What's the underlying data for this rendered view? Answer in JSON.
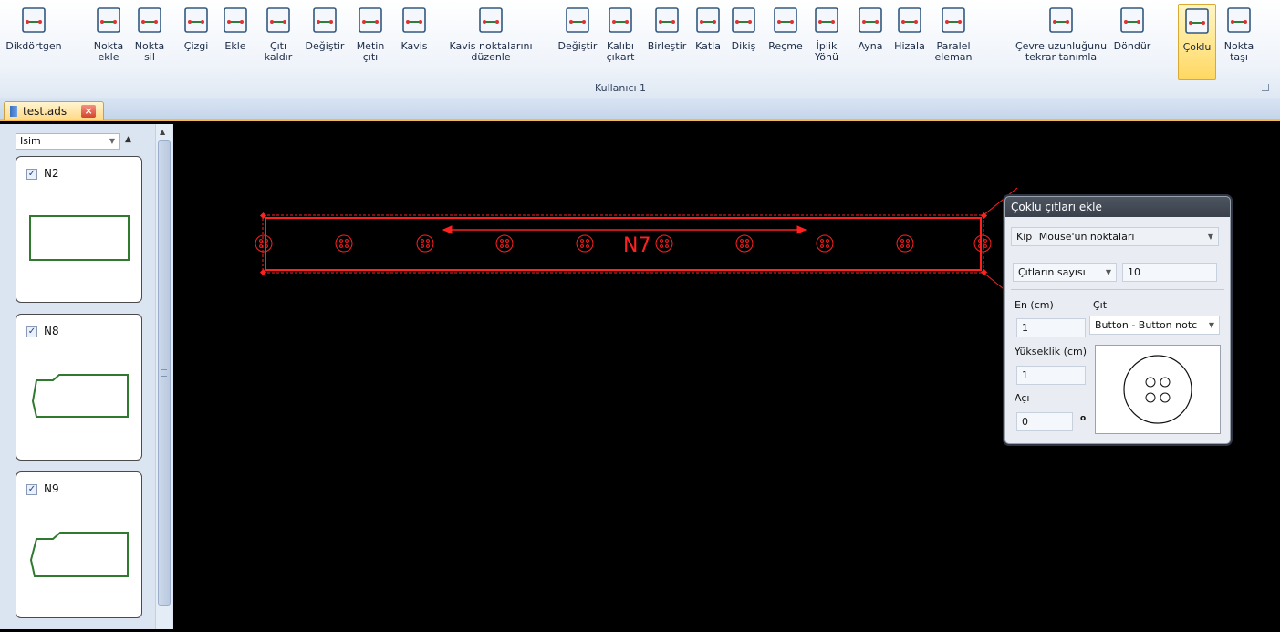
{
  "ribbon": {
    "group_label": "Kullanıcı 1",
    "tools": [
      {
        "label": "Dikdörtgen",
        "icon": "rectangle-icon"
      },
      {
        "label": "Nokta\nekle",
        "icon": "add-point-icon"
      },
      {
        "label": "Nokta\nsil",
        "icon": "delete-point-icon"
      },
      {
        "label": "Çizgi",
        "icon": "line-icon"
      },
      {
        "label": "Ekle",
        "icon": "insert-icon"
      },
      {
        "label": "Çıtı\nkaldır",
        "icon": "remove-notch-icon"
      },
      {
        "label": "Değiştir",
        "icon": "change-notch-icon"
      },
      {
        "label": "Metin\nçıtı",
        "icon": "text-notch-icon"
      },
      {
        "label": "Kavis",
        "icon": "curve-icon"
      },
      {
        "label": "Kavis noktalarını\ndüzenle",
        "icon": "edit-curve-points-icon"
      },
      {
        "label": "Değiştir",
        "icon": "modify-icon"
      },
      {
        "label": "Kalıbı\nçıkart",
        "icon": "extract-pattern-icon"
      },
      {
        "label": "Birleştir",
        "icon": "merge-icon"
      },
      {
        "label": "Katla",
        "icon": "fold-icon"
      },
      {
        "label": "Dikiş",
        "icon": "seam-icon"
      },
      {
        "label": "Reçme",
        "icon": "pleat-icon"
      },
      {
        "label": "İplik\nYönü",
        "icon": "grain-line-icon"
      },
      {
        "label": "Ayna",
        "icon": "mirror-icon"
      },
      {
        "label": "Hizala",
        "icon": "align-icon"
      },
      {
        "label": "Paralel\neleman",
        "icon": "parallel-icon"
      },
      {
        "label": "Çevre uzunluğunu\ntekrar tanımla",
        "icon": "perimeter-icon"
      },
      {
        "label": "Döndür",
        "icon": "rotate-icon"
      },
      {
        "label": "Çoklu",
        "icon": "multiple-notches-icon",
        "active": true
      },
      {
        "label": "Nokta\ntaşı",
        "icon": "move-point-icon"
      }
    ]
  },
  "tabs": {
    "doc_name": "test.ads",
    "close": "×"
  },
  "sidebar": {
    "sort_field": "Isim",
    "pieces": [
      {
        "name": "N2",
        "checked": "✓"
      },
      {
        "name": "N8",
        "checked": "✓"
      },
      {
        "name": "N9",
        "checked": "✓"
      }
    ]
  },
  "canvas": {
    "piece_label": "N7",
    "color": "#ff2020"
  },
  "dialog": {
    "title": "Çoklu çıtları ekle",
    "kip_label": "Kip",
    "kip_value": "Mouse'un noktaları",
    "count_mode": "Çıtların sayısı",
    "count_value": "10",
    "width_label": "En (cm)",
    "width_value": "1",
    "notch_label": "Çıt",
    "notch_value": "Button - Button notc",
    "height_label": "Yükseklik (cm)",
    "height_value": "1",
    "angle_label": "Açı",
    "angle_value": "0",
    "angle_unit": "o"
  }
}
